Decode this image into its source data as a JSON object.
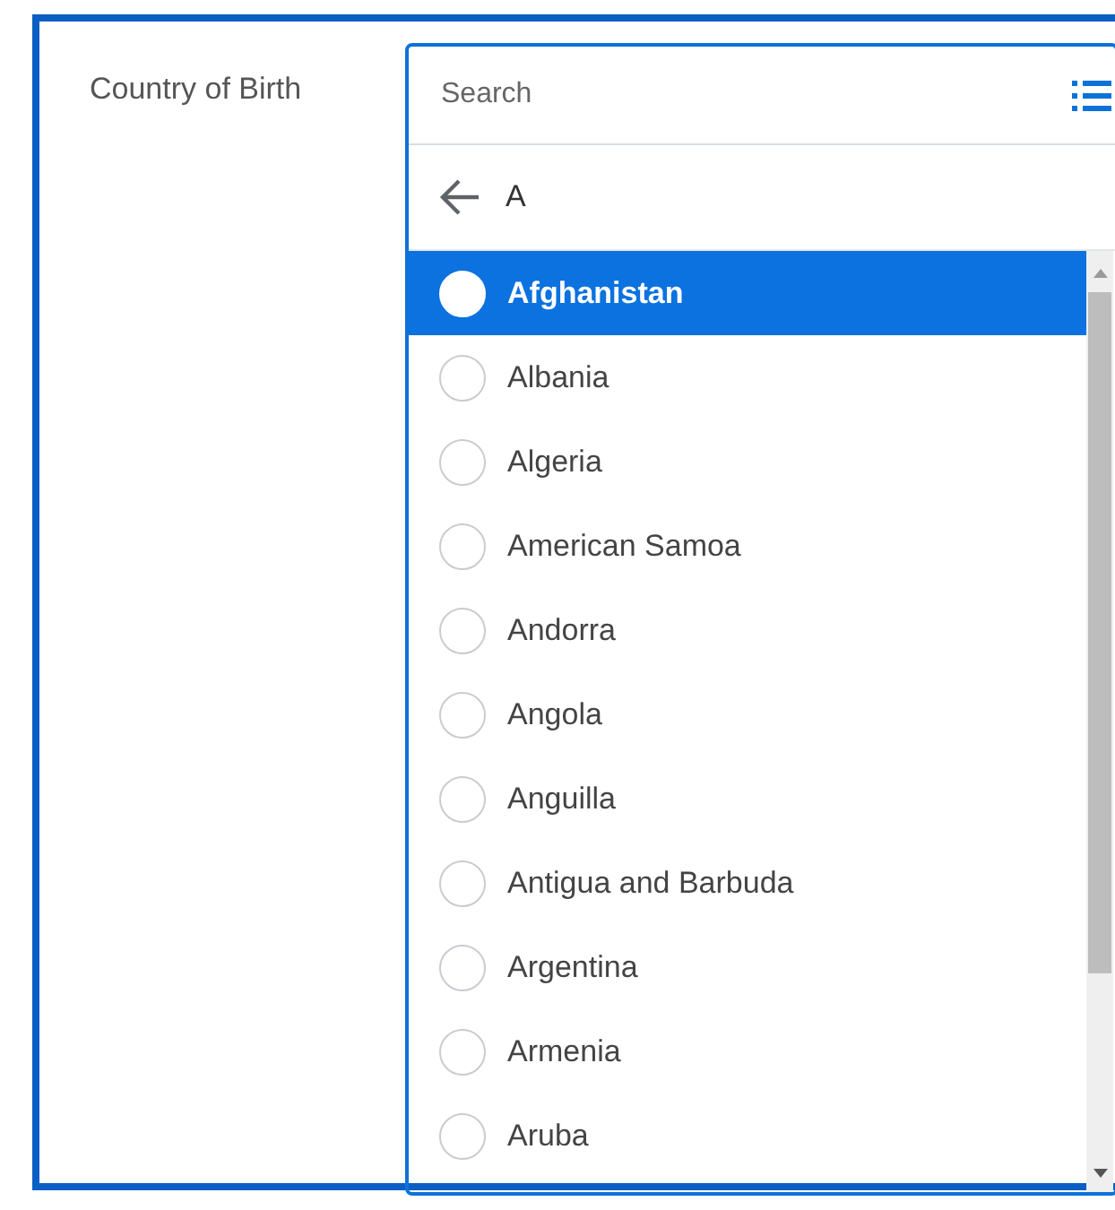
{
  "field": {
    "label": "Country of Birth"
  },
  "search": {
    "placeholder": "Search"
  },
  "category": {
    "title": "A"
  },
  "options": [
    {
      "label": "Afghanistan",
      "selected": true
    },
    {
      "label": "Albania",
      "selected": false
    },
    {
      "label": "Algeria",
      "selected": false
    },
    {
      "label": "American Samoa",
      "selected": false
    },
    {
      "label": "Andorra",
      "selected": false
    },
    {
      "label": "Angola",
      "selected": false
    },
    {
      "label": "Anguilla",
      "selected": false
    },
    {
      "label": "Antigua and Barbuda",
      "selected": false
    },
    {
      "label": "Argentina",
      "selected": false
    },
    {
      "label": "Armenia",
      "selected": false
    },
    {
      "label": "Aruba",
      "selected": false
    }
  ]
}
